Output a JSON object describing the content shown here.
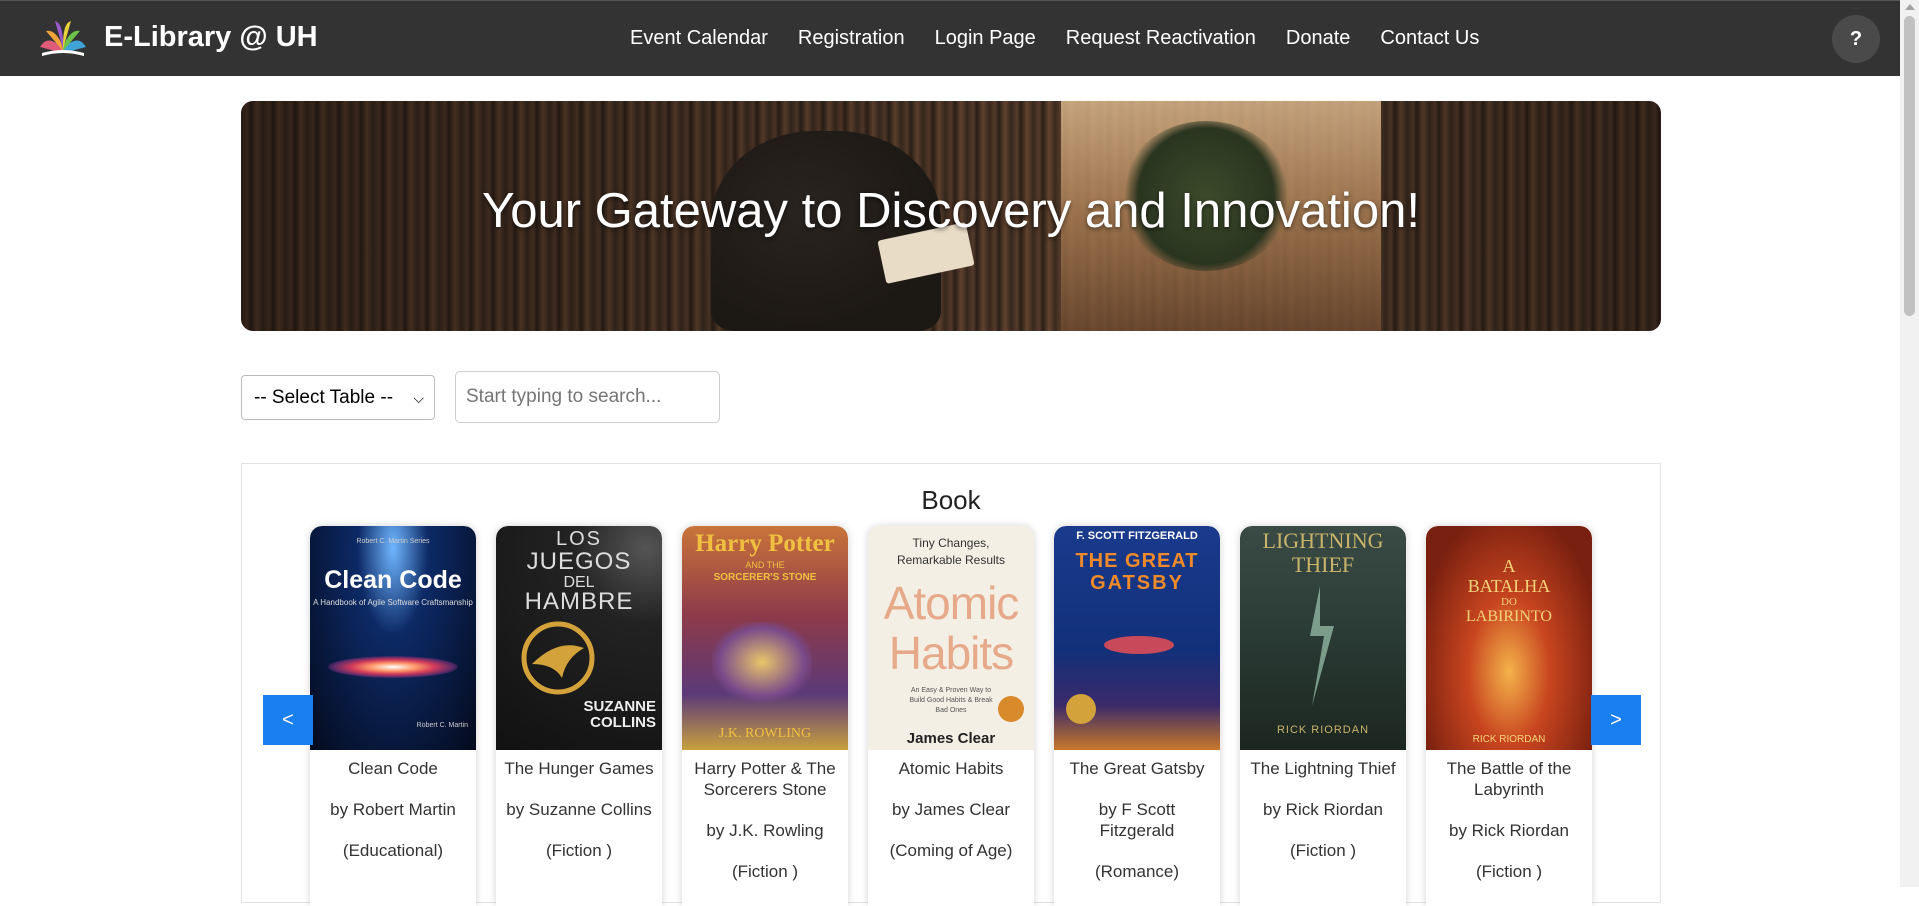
{
  "brand": {
    "name": "E-Library @ UH",
    "logo_icon": "lotus-book-logo-icon"
  },
  "nav": {
    "links": [
      "Event Calendar",
      "Registration",
      "Login Page",
      "Request Reactivation",
      "Donate",
      "Contact Us"
    ],
    "help_label": "?"
  },
  "hero": {
    "title": "Your Gateway to Discovery and Innovation!"
  },
  "search": {
    "table_select_value": "-- Select Table --",
    "placeholder": "Start typing to search..."
  },
  "books_section": {
    "title": "Book",
    "prev_label": "<",
    "next_label": ">",
    "books": [
      {
        "title": "Clean Code",
        "author": "by Robert Martin",
        "genre": "(Educational)",
        "cover": {
          "bg": "#0b1a3a",
          "accent": "#ffffff",
          "lines": [
            "Robert C. Martin Series",
            "Clean Code",
            "A Handbook of Agile Software Craftsmanship",
            "Robert C. Martin"
          ]
        }
      },
      {
        "title": "The Hunger Games",
        "author": "by Suzanne Collins",
        "genre": "(Fiction )",
        "cover": {
          "bg": "#161616",
          "accent": "#d9d9d9",
          "lines": [
            "LOS",
            "JUEGOS",
            "DEL",
            "HAMBRE",
            "SUZANNE",
            "COLLINS"
          ]
        }
      },
      {
        "title": "Harry Potter & The Sorcerers Stone",
        "author": "by J.K. Rowling",
        "genre": "(Fiction )",
        "cover": {
          "bg": "#8b3a3a",
          "accent": "#f0c040",
          "lines": [
            "Harry Potter",
            "AND THE",
            "SORCERER'S STONE",
            "J.K. ROWLING"
          ]
        }
      },
      {
        "title": "Atomic Habits",
        "author": "by James Clear",
        "genre": "(Coming of Age)",
        "cover": {
          "bg": "#f3efe6",
          "accent": "#e3a98a",
          "lines": [
            "Tiny Changes,",
            "Remarkable Results",
            "Atomic",
            "Habits",
            "An Easy & Proven Way to Build Good Habits & Break Bad Ones",
            "James Clear"
          ]
        }
      },
      {
        "title": "The Great Gatsby",
        "author": "by F Scott Fitzgerald",
        "genre": "(Romance)",
        "cover": {
          "bg": "#1a3e8c",
          "accent": "#f08a2a",
          "lines": [
            "F. SCOTT FITZGERALD",
            "THE GREAT",
            "GATSBY"
          ]
        }
      },
      {
        "title": "The Lightning Thief",
        "author": "by Rick Riordan",
        "genre": "(Fiction )",
        "cover": {
          "bg": "#2c3a30",
          "accent": "#c9b46a",
          "lines": [
            "LIGHTNING",
            "THIEF",
            "RICK RIORDAN"
          ]
        }
      },
      {
        "title": "The Battle of the Labyrinth",
        "author": "by Rick Riordan",
        "genre": "(Fiction )",
        "cover": {
          "bg": "#a8331f",
          "accent": "#f3d37a",
          "lines": [
            "A",
            "BATALHA",
            "DO",
            "LABIRINTO",
            "RICK RIORDAN"
          ]
        }
      }
    ]
  }
}
